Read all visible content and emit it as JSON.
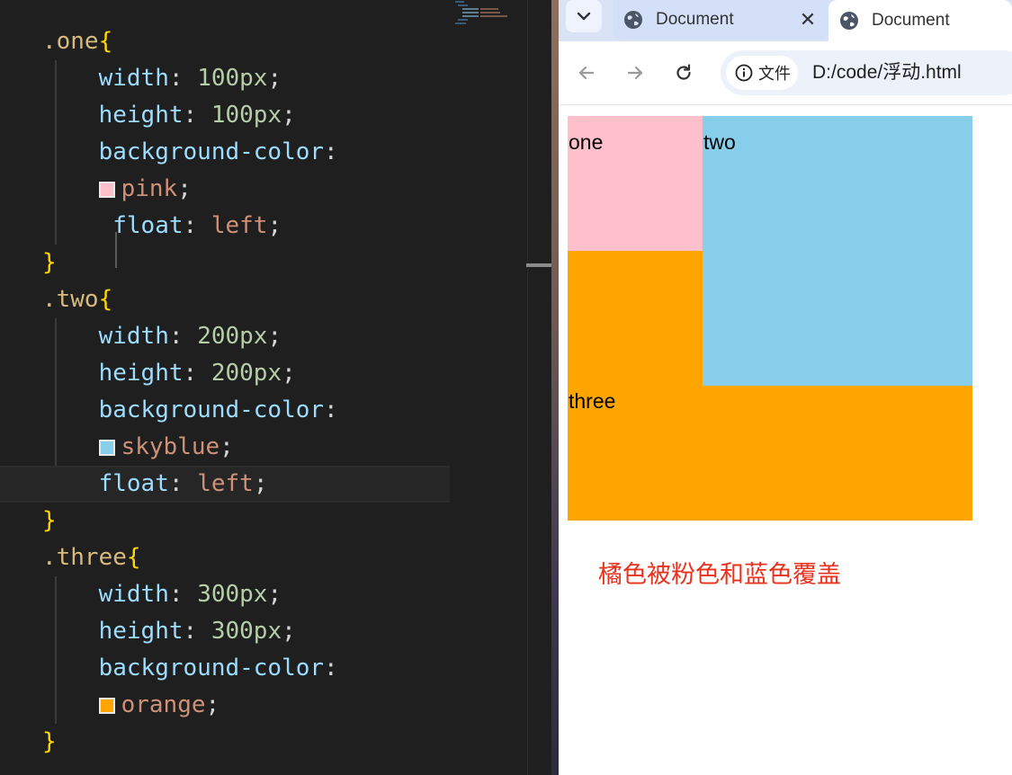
{
  "editor": {
    "lines": [
      [
        {
          "t": ".one",
          "c": "t-sel"
        },
        {
          "t": "{",
          "c": "t-brace"
        }
      ],
      [
        {
          "t": "    "
        },
        {
          "t": "width",
          "c": "t-prop"
        },
        {
          "t": ": ",
          "c": "t-punc"
        },
        {
          "t": "100px",
          "c": "t-num"
        },
        {
          "t": ";",
          "c": "t-punc"
        }
      ],
      [
        {
          "t": "    "
        },
        {
          "t": "height",
          "c": "t-prop"
        },
        {
          "t": ": ",
          "c": "t-punc"
        },
        {
          "t": "100px",
          "c": "t-num"
        },
        {
          "t": ";",
          "c": "t-punc"
        }
      ],
      [
        {
          "t": "    "
        },
        {
          "t": "background-color",
          "c": "t-prop"
        },
        {
          "t": ":",
          "c": "t-punc"
        }
      ],
      [
        {
          "t": "    "
        },
        {
          "swatch": "#ffc0cb"
        },
        {
          "t": "pink",
          "c": "t-val"
        },
        {
          "t": ";",
          "c": "t-punc"
        }
      ],
      [
        {
          "t": "     "
        },
        {
          "t": "float",
          "c": "t-prop"
        },
        {
          "t": ": ",
          "c": "t-punc"
        },
        {
          "t": "left",
          "c": "t-val"
        },
        {
          "t": ";",
          "c": "t-punc"
        }
      ],
      [
        {
          "t": "}",
          "c": "t-brace"
        }
      ],
      [
        {
          "t": ".two",
          "c": "t-sel"
        },
        {
          "t": "{",
          "c": "t-brace"
        }
      ],
      [
        {
          "t": "    "
        },
        {
          "t": "width",
          "c": "t-prop"
        },
        {
          "t": ": ",
          "c": "t-punc"
        },
        {
          "t": "200px",
          "c": "t-num"
        },
        {
          "t": ";",
          "c": "t-punc"
        }
      ],
      [
        {
          "t": "    "
        },
        {
          "t": "height",
          "c": "t-prop"
        },
        {
          "t": ": ",
          "c": "t-punc"
        },
        {
          "t": "200px",
          "c": "t-num"
        },
        {
          "t": ";",
          "c": "t-punc"
        }
      ],
      [
        {
          "t": "    "
        },
        {
          "t": "background-color",
          "c": "t-prop"
        },
        {
          "t": ":",
          "c": "t-punc"
        }
      ],
      [
        {
          "t": "    "
        },
        {
          "swatch": "#87ceeb"
        },
        {
          "t": "skyblue",
          "c": "t-val"
        },
        {
          "t": ";",
          "c": "t-punc"
        }
      ],
      [
        {
          "t": "    "
        },
        {
          "t": "float",
          "c": "t-prop"
        },
        {
          "t": ": ",
          "c": "t-punc"
        },
        {
          "t": "left",
          "c": "t-val"
        },
        {
          "t": ";",
          "c": "t-punc"
        }
      ],
      [
        {
          "t": "}",
          "c": "t-brace"
        }
      ],
      [
        {
          "t": ".three",
          "c": "t-sel"
        },
        {
          "t": "{",
          "c": "t-brace"
        }
      ],
      [
        {
          "t": "    "
        },
        {
          "t": "width",
          "c": "t-prop"
        },
        {
          "t": ": ",
          "c": "t-punc"
        },
        {
          "t": "300px",
          "c": "t-num"
        },
        {
          "t": ";",
          "c": "t-punc"
        }
      ],
      [
        {
          "t": "    "
        },
        {
          "t": "height",
          "c": "t-prop"
        },
        {
          "t": ": ",
          "c": "t-punc"
        },
        {
          "t": "300px",
          "c": "t-num"
        },
        {
          "t": ";",
          "c": "t-punc"
        }
      ],
      [
        {
          "t": "    "
        },
        {
          "t": "background-color",
          "c": "t-prop"
        },
        {
          "t": ":",
          "c": "t-punc"
        }
      ],
      [
        {
          "t": "    "
        },
        {
          "swatch": "#ffa500"
        },
        {
          "t": "orange",
          "c": "t-val"
        },
        {
          "t": ";",
          "c": "t-punc"
        }
      ],
      [
        {
          "t": "}",
          "c": "t-brace"
        }
      ]
    ],
    "current_line": 12
  },
  "browser": {
    "tabs": [
      {
        "title": "Document",
        "icon": "globe-icon",
        "active": false
      },
      {
        "title": "Document",
        "icon": "globe-icon",
        "active": true
      }
    ],
    "site_info_label": "文件",
    "url": "D:/code/浮动.html"
  },
  "page": {
    "boxes": {
      "one": {
        "label": "one",
        "color": "#ffc0cb"
      },
      "two": {
        "label": "two",
        "color": "#87ceeb"
      },
      "three": {
        "label": "three",
        "color": "#ffa500"
      }
    },
    "annotation": "橘色被粉色和蓝色覆盖"
  }
}
